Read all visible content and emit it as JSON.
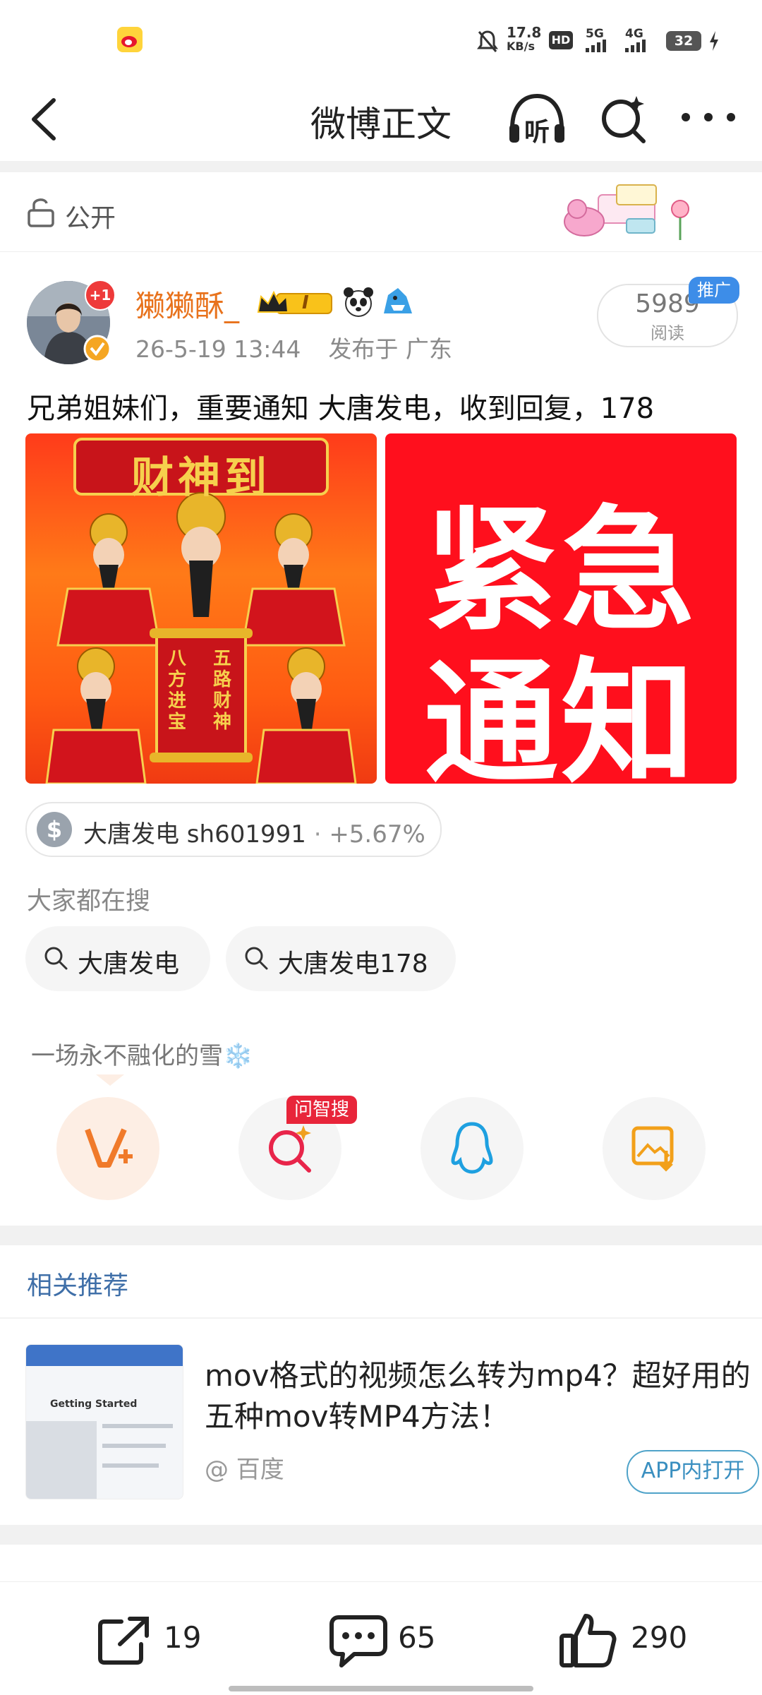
{
  "status_bar": {
    "net_speed": "17.8",
    "net_unit": "KB/s",
    "hd": "HD",
    "sig5g": "5G",
    "sig4g": "4G",
    "battery": "32"
  },
  "nav": {
    "title": "微博正文",
    "listen_label": "听"
  },
  "visibility": {
    "label": "公开"
  },
  "post": {
    "avatar_badge": "+1",
    "username": "獭獭酥_",
    "level_badge": "I",
    "timestamp": "26-5-19 13:44",
    "location": "发布于 广东",
    "read_count": "5989",
    "read_label": "阅读",
    "promo_tag": "推广",
    "text": "兄弟姐妹们，重要通知 大唐发电，收到回复，178",
    "image1": {
      "banner": "财神到",
      "scroll_left": "八方进宝",
      "scroll_right": "五路财神"
    },
    "image2": {
      "line1": "紧急",
      "line2": "通知"
    }
  },
  "stock": {
    "icon_symbol": "$",
    "name": "大唐发电 sh601991",
    "separator": "·",
    "change": "+5.67%",
    "change_color": "#8a8a8a"
  },
  "search_section": {
    "label": "大家都在搜",
    "chips": [
      {
        "text": "大唐发电"
      },
      {
        "text": "大唐发电178"
      }
    ]
  },
  "share": {
    "caption": "一场永不融化的雪❄️",
    "wzs_badge": "问智搜"
  },
  "related": {
    "title": "相关推荐",
    "item": {
      "title": "mov格式的视频怎么转为mp4？超好用的五种mov转MP4方法！",
      "source": "@ 百度",
      "open_label": "APP内打开",
      "thumb_heading": "Getting Started"
    }
  },
  "actions": {
    "repost_count": "19",
    "comment_count": "65",
    "like_count": "290"
  },
  "colors": {
    "username": "#e8721c",
    "link_blue": "#3f6fa8",
    "badge_red": "#e8253a"
  }
}
